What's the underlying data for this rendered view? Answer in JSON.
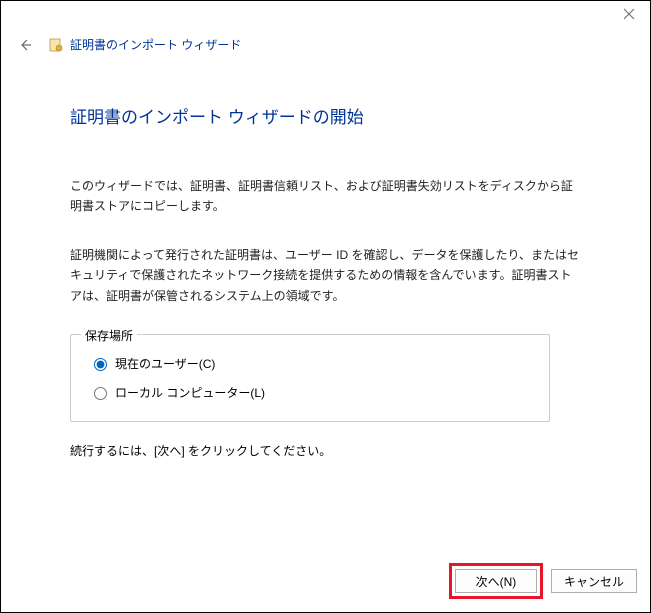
{
  "window": {
    "title": "証明書のインポート ウィザード"
  },
  "main": {
    "heading": "証明書のインポート ウィザードの開始",
    "intro": "このウィザードでは、証明書、証明書信頼リスト、および証明書失効リストをディスクから証明書ストアにコピーします。",
    "description": "証明機関によって発行された証明書は、ユーザー ID を確認し、データを保護したり、またはセキュリティで保護されたネットワーク接続を提供するための情報を含んでいます。証明書ストアは、証明書が保管されるシステム上の領域です。",
    "storage_legend": "保存場所",
    "radio_current_user": "現在のユーザー(C)",
    "radio_local_computer": "ローカル コンピューター(L)",
    "continue_hint": "続行するには、[次へ] をクリックしてください。"
  },
  "buttons": {
    "next": "次へ(N)",
    "cancel": "キャンセル"
  }
}
